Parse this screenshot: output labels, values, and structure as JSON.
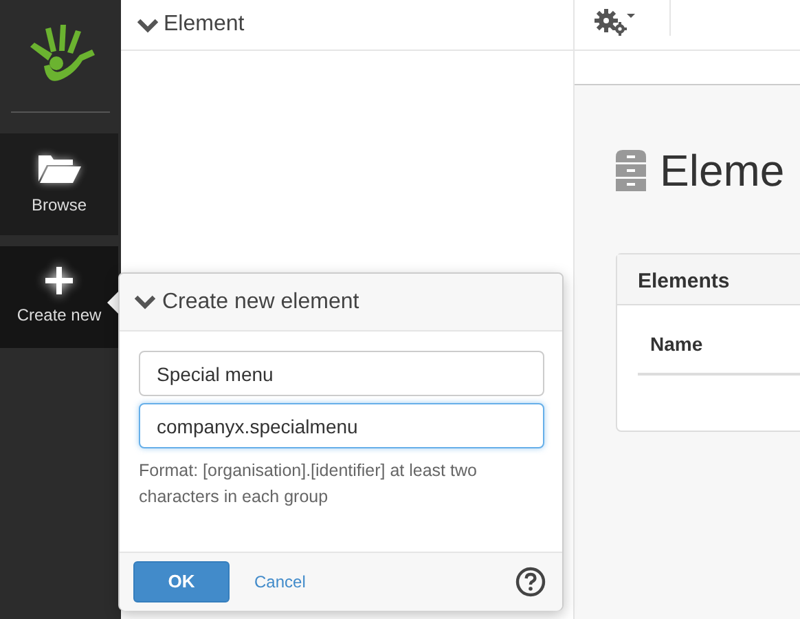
{
  "sidebar": {
    "items": [
      {
        "label": "Browse",
        "kind": "folder",
        "selected": false
      },
      {
        "label": "Create new",
        "kind": "plus",
        "selected": true
      }
    ]
  },
  "element_panel": {
    "title": "Element"
  },
  "content": {
    "heading": "Eleme",
    "card": {
      "title": "Elements",
      "columns": [
        "Name"
      ]
    }
  },
  "popup": {
    "title": "Create new element",
    "fields": [
      {
        "value": "Special menu",
        "focused": false
      },
      {
        "value": "companyx.specialmenu",
        "focused": true
      }
    ],
    "hint": "Format: [organisation].[identifier] at least two characters in each group",
    "buttons": [
      {
        "label": "OK",
        "kind": "primary"
      },
      {
        "label": "Cancel",
        "kind": "link"
      }
    ]
  }
}
